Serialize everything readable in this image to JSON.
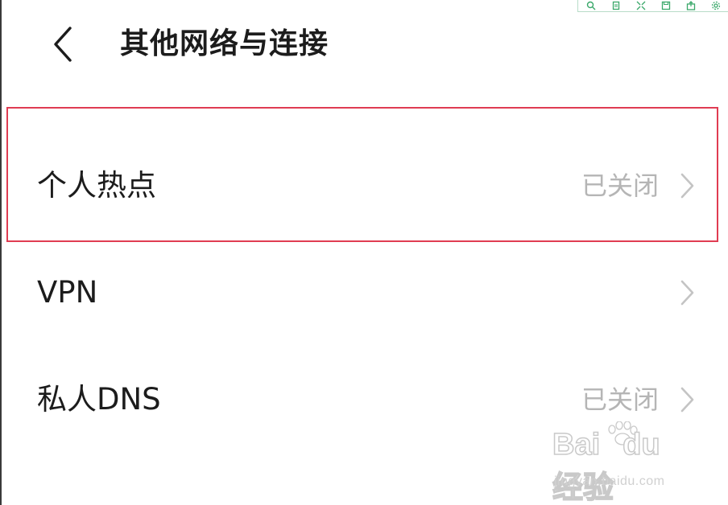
{
  "header": {
    "title": "其他网络与连接"
  },
  "rows": [
    {
      "label": "个人热点",
      "value": "已关闭"
    },
    {
      "label": "VPN",
      "value": ""
    },
    {
      "label": "私人DNS",
      "value": "已关闭"
    }
  ],
  "watermark": {
    "brand_a": "Bai",
    "brand_b": "du",
    "brand_c": "经验",
    "site": "jingyan.baidu.com"
  },
  "icons": {
    "back": "chevron-left-icon",
    "row_arrow": "chevron-right-icon",
    "toolbar": [
      "search-icon",
      "copy-icon",
      "expand-icon",
      "save-icon",
      "export-icon",
      "settings-icon"
    ]
  },
  "colors": {
    "text": "#1c1c1c",
    "secondary": "#b5b5b5",
    "highlight": "#e03c52",
    "toolbar_accent": "#3aa86a"
  }
}
